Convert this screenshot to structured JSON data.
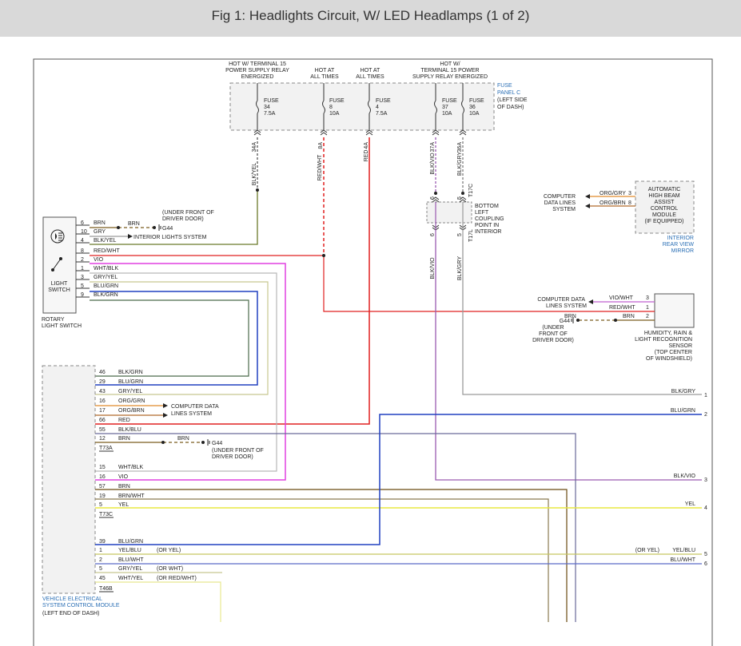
{
  "title": "Fig 1: Headlights Circuit, W/ LED Headlamps (1 of 2)",
  "power_labels": {
    "hot15_a": [
      "HOT W/ TERMINAL 15",
      "POWER SUPPLY RELAY",
      "ENERGIZED"
    ],
    "hot_all_8": [
      "HOT AT",
      "ALL TIMES"
    ],
    "hot_all_4": [
      "HOT AT",
      "ALL TIMES"
    ],
    "hot15_b": [
      "HOT W/",
      "TERMINAL 15 POWER",
      "SUPPLY RELAY ENERGIZED"
    ]
  },
  "fuse_panel": {
    "label": [
      "FUSE",
      "PANEL C",
      "(LEFT SIDE",
      "OF DASH)"
    ],
    "fuses": [
      {
        "name": "FUSE",
        "num": "34",
        "rating": "7.5A"
      },
      {
        "name": "FUSE",
        "num": "8",
        "rating": "10A"
      },
      {
        "name": "FUSE",
        "num": "4",
        "rating": "7.5A"
      },
      {
        "name": "FUSE",
        "num": "37",
        "rating": "10A"
      },
      {
        "name": "FUSE",
        "num": "36",
        "rating": "10A"
      }
    ],
    "pins": [
      "34A",
      "8A",
      "4A",
      "37A",
      "36A"
    ]
  },
  "vertical_wires": [
    "BLK/YEL",
    "RED/WHT",
    "RED",
    "BLK/VIO",
    "BLK/GRY"
  ],
  "coupling": {
    "label": [
      "BOTTOM",
      "LEFT",
      "COUPLING",
      "POINT IN",
      "INTERIOR"
    ],
    "pins_top": [
      "6",
      "5"
    ],
    "pins_bottom": [
      "6",
      "5"
    ],
    "connector_top": "T17C",
    "connector_bottom": "T17L",
    "wires_below": [
      "BLK/VIO",
      "BLK/GRY"
    ]
  },
  "light_switch": {
    "label": [
      "LIGHT",
      "SWITCH"
    ],
    "caption": [
      "ROTARY",
      "LIGHT SWITCH"
    ],
    "pins": [
      {
        "pin": "6",
        "wire": "BRN"
      },
      {
        "pin": "10",
        "wire": "GRY"
      },
      {
        "pin": "4",
        "wire": "BLK/YEL"
      },
      {
        "pin": "8",
        "wire": "RED/WHT"
      },
      {
        "pin": "2",
        "wire": "VIO"
      },
      {
        "pin": "1",
        "wire": "WHT/BLK"
      },
      {
        "pin": "3",
        "wire": "GRY/YEL"
      },
      {
        "pin": "5",
        "wire": "BLU/GRN"
      },
      {
        "pin": "9",
        "wire": "BLK/GRN"
      }
    ],
    "brn_wire": "BRN",
    "ground": "G44",
    "ground_location": [
      "(UNDER FRONT OF",
      "DRIVER DOOR)"
    ],
    "interior_lights": "INTERIOR LIGHTS SYSTEM"
  },
  "high_beam_module": {
    "label": [
      "AUTOMATIC",
      "HIGH BEAM",
      "ASSIST",
      "CONTROL",
      "MODULE",
      "(IF EQUIPPED)"
    ],
    "location": [
      "INTERIOR",
      "REAR VIEW",
      "MIRROR"
    ],
    "computer_label": [
      "COMPUTER",
      "DATA LINES",
      "SYSTEM"
    ],
    "pins": [
      {
        "pin": "3",
        "wire": "ORG/GRY"
      },
      {
        "pin": "8",
        "wire": "ORG/BRN"
      }
    ]
  },
  "rain_sensor": {
    "label": [
      "HUMIDITY, RAIN &",
      "LIGHT RECOGNITION",
      "SENSOR",
      "(TOP CENTER",
      "OF WINDSHIELD)"
    ],
    "computer_label": [
      "COMPUTER DATA",
      "LINES SYSTEM"
    ],
    "pins": [
      {
        "pin": "3",
        "wire": "VIO/WHT"
      },
      {
        "pin": "1",
        "wire": "RED/WHT"
      },
      {
        "pin": "2",
        "wire": "BRN"
      }
    ],
    "ground": "G44",
    "ground_brn": "BRN",
    "ground_location": [
      "(UNDER",
      "FRONT OF",
      "DRIVER DOOR)"
    ]
  },
  "vecm": {
    "label": [
      "VEHICLE ELECTRICAL",
      "SYSTEM CONTROL MODULE"
    ],
    "sublabel": "(LEFT END OF DASH)",
    "group_a": [
      {
        "pin": "46",
        "wire": "BLK/GRN"
      },
      {
        "pin": "29",
        "wire": "BLU/GRN"
      },
      {
        "pin": "43",
        "wire": "GRY/YEL"
      },
      {
        "pin": "16",
        "wire": "ORG/GRN"
      },
      {
        "pin": "17",
        "wire": "ORG/BRN"
      },
      {
        "pin": "66",
        "wire": "RED"
      },
      {
        "pin": "55",
        "wire": "BLK/BLU"
      },
      {
        "pin": "12",
        "wire": "BRN"
      }
    ],
    "connector_a": "T73A",
    "computer_label": [
      "COMPUTER DATA",
      "LINES SYSTEM"
    ],
    "ground_brn": "BRN",
    "ground": "G44",
    "ground_location": [
      "(UNDER FRONT OF",
      "DRIVER DOOR)"
    ],
    "group_c": [
      {
        "pin": "15",
        "wire": "WHT/BLK"
      },
      {
        "pin": "16",
        "wire": "VIO"
      },
      {
        "pin": "57",
        "wire": "BRN"
      },
      {
        "pin": "19",
        "wire": "BRN/WHT"
      },
      {
        "pin": "5",
        "wire": "YEL"
      }
    ],
    "connector_c": "T73C",
    "group_b": [
      {
        "pin": "39",
        "wire": "BLU/GRN",
        "note": ""
      },
      {
        "pin": "1",
        "wire": "YEL/BLU",
        "note": "(OR YEL)"
      },
      {
        "pin": "2",
        "wire": "BLU/WHT",
        "note": ""
      },
      {
        "pin": "5",
        "wire": "GRY/YEL",
        "note": "(OR WHT)"
      },
      {
        "pin": "45",
        "wire": "WHT/YEL",
        "note": "(OR RED/WHT)"
      }
    ],
    "connector_b": "T46B"
  },
  "continuations": [
    {
      "num": "1",
      "wire": "BLK/GRY",
      "note": ""
    },
    {
      "num": "2",
      "wire": "BLU/GRN",
      "note": ""
    },
    {
      "num": "3",
      "wire": "BLK/VIO",
      "note": ""
    },
    {
      "num": "4",
      "wire": "YEL",
      "note": ""
    },
    {
      "num": "5",
      "wire": "YEL/BLU",
      "note": "(OR YEL)"
    },
    {
      "num": "6",
      "wire": "BLU/WHT",
      "note": ""
    }
  ],
  "colors": {
    "brn": "#7a5c1e",
    "olive": "#6b7a2a",
    "red": "#e02020",
    "magenta": "#e040e0",
    "gray": "#9a9a9a",
    "tan": "#c8c890",
    "blue": "#2040c0",
    "purple": "#9a5ab0",
    "orange": "#e08a2a",
    "yellow": "#e8e840",
    "darkbrn": "#6a4a10",
    "black": "#222222",
    "label_blue": "#2b6fb5"
  }
}
